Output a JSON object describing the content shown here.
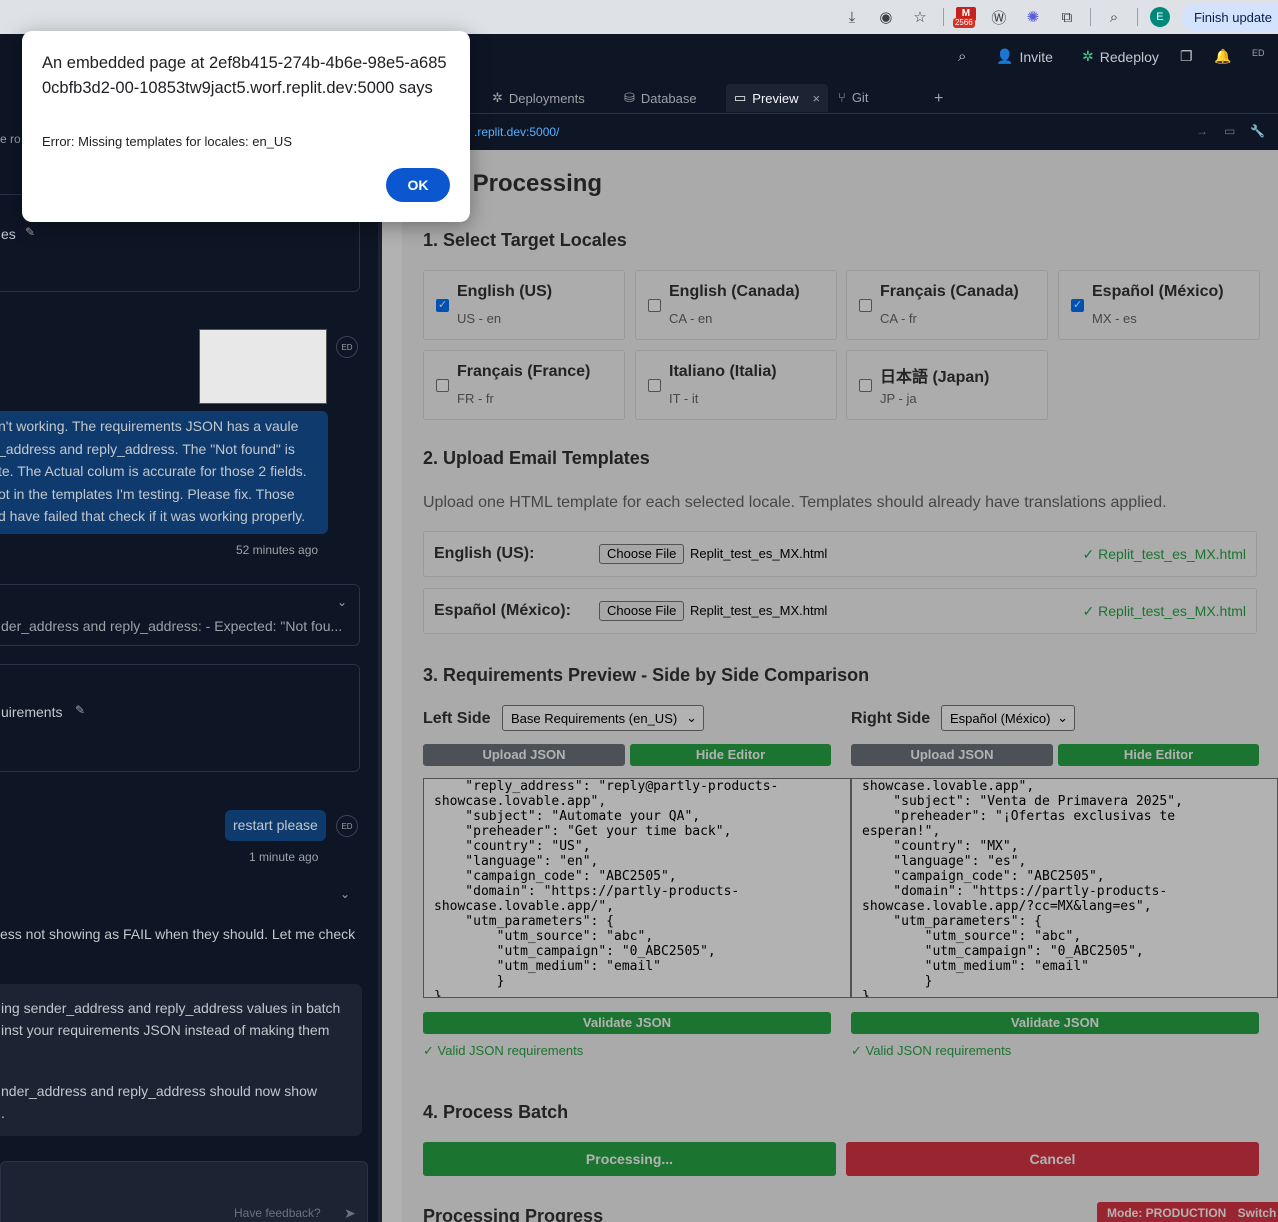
{
  "chrome": {
    "gmail_count": "2566",
    "profile_initial": "E",
    "finish_update": "Finish update"
  },
  "left": {
    "tab_fragment": "e ro",
    "card1_fragment": "es",
    "user_message": [
      "n't working. The requirements JSON has a vaule",
      "_address and reply_address. The \"Not found\" is",
      "te. The Actual colum is accurate for those 2 fields.",
      "ot in the templates I'm testing. Please fix. Those",
      "d have failed that check if it was working properly."
    ],
    "user_time": "52 minutes ago",
    "avatar": "ED",
    "collapsed_summary": "der_address and reply_address: - Expected: \"Not fou...",
    "card2_fragment": "uirements",
    "restart_message": "restart please",
    "restart_time": "1 minute ago",
    "agent_line": "ess not showing as FAIL when they should. Let me check",
    "agent_block": [
      "ing sender_address and reply_address values in batch",
      "inst your requirements JSON instead of making them",
      "",
      "nder_address and reply_address should now show",
      "."
    ],
    "feedback": "Have feedback?"
  },
  "topbar": {
    "invite": "Invite",
    "redeploy": "Redeploy",
    "avatar": "ED"
  },
  "tabs": [
    "Deployments",
    "Database",
    "Preview",
    "Git"
  ],
  "url": ".replit.dev:5000/",
  "app": {
    "title": "ch Processing",
    "step1": "1. Select Target Locales",
    "locales": [
      {
        "name": "English (US)",
        "code": "US - en",
        "checked": true
      },
      {
        "name": "English (Canada)",
        "code": "CA - en",
        "checked": false
      },
      {
        "name": "Français (Canada)",
        "code": "CA - fr",
        "checked": false
      },
      {
        "name": "Español (México)",
        "code": "MX - es",
        "checked": true
      },
      {
        "name": "Français (France)",
        "code": "FR - fr",
        "checked": false
      },
      {
        "name": "Italiano (Italia)",
        "code": "IT - it",
        "checked": false
      },
      {
        "name": "日本語 (Japan)",
        "code": "JP - ja",
        "checked": false
      }
    ],
    "step2": "2. Upload Email Templates",
    "step2_desc": "Upload one HTML template for each selected locale. Templates should already have translations applied.",
    "uploads": [
      {
        "label": "English (US):",
        "button": "Choose File",
        "file": "Replit_test_es_MX.html",
        "status": "✓ Replit_test_es_MX.html"
      },
      {
        "label": "Español (México):",
        "button": "Choose File",
        "file": "Replit_test_es_MX.html",
        "status": "✓ Replit_test_es_MX.html"
      }
    ],
    "step3": "3. Requirements Preview - Side by Side Comparison",
    "left_side": "Left Side",
    "left_select": "Base Requirements (en_US)",
    "right_side": "Right Side",
    "right_select": "Español (México)",
    "upload_json": "Upload JSON",
    "hide_editor": "Hide Editor",
    "left_json": "    \"reply_address\": \"reply@partly-products-\nshowcase.lovable.app\",\n    \"subject\": \"Automate your QA\",\n    \"preheader\": \"Get your time back\",\n    \"country\": \"US\",\n    \"language\": \"en\",\n    \"campaign_code\": \"ABC2505\",\n    \"domain\": \"https://partly-products-\nshowcase.lovable.app/\",\n    \"utm_parameters\": {\n        \"utm_source\": \"abc\",\n        \"utm_campaign\": \"0_ABC2505\",\n        \"utm_medium\": \"email\"\n        }\n}",
    "right_json": "showcase.lovable.app\",\n    \"subject\": \"Venta de Primavera 2025\",\n    \"preheader\": \"¡Ofertas exclusivas te\nesperan!\",\n    \"country\": \"MX\",\n    \"language\": \"es\",\n    \"campaign_code\": \"ABC2505\",\n    \"domain\": \"https://partly-products-\nshowcase.lovable.app/?cc=MX&lang=es\",\n    \"utm_parameters\": {\n        \"utm_source\": \"abc\",\n        \"utm_campaign\": \"0_ABC2505\",\n        \"utm_medium\": \"email\"\n        }\n}",
    "validate": "Validate JSON",
    "valid_msg": "✓ Valid JSON requirements",
    "step4": "4. Process Batch",
    "processing": "Processing...",
    "cancel": "Cancel",
    "progress_title": "Processing Progress",
    "mode_badge": "Mode: PRODUCTION",
    "switch": "Switch"
  },
  "dialog": {
    "title": "An embedded page at 2ef8b415-274b-4b6e-98e5-a6850cbfb3d2-00-10853tw9jact5.worf.replit.dev:5000 says",
    "message": "Error: Missing templates for locales: en_US",
    "ok": "OK"
  }
}
